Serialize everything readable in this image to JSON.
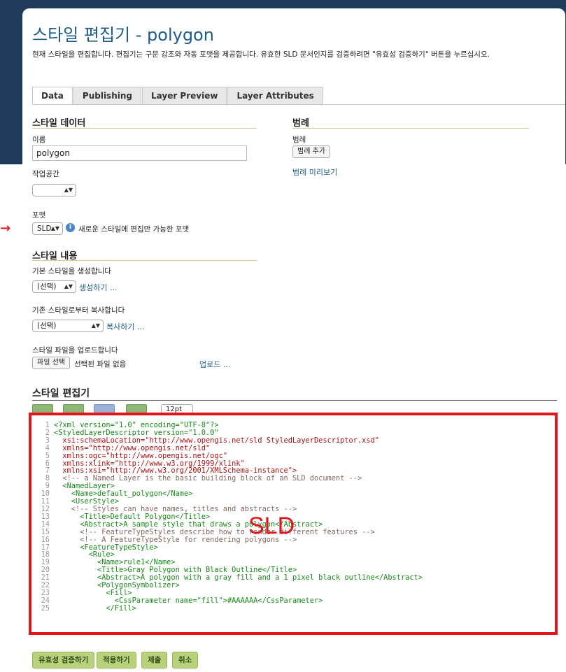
{
  "page": {
    "title": "스타일 편집기 - polygon",
    "subtitle": "현재 스타일을 편집합니다. 편집기는 구문 강조와 자동 포맷을 제공합니다. 유효한 SLD 문서인지를 검증하려면 \"유효성 검증하기\" 버튼을 누르십시오."
  },
  "tabs": [
    "Data",
    "Publishing",
    "Layer Preview",
    "Layer Attributes"
  ],
  "style_data": {
    "heading": "스타일 데이터",
    "name_label": "이름",
    "name_value": "polygon",
    "workspace_label": "작업공간",
    "workspace_value": "",
    "format_label": "포맷",
    "format_value": "SLD",
    "format_note": "새로운 스타일에 편집만 가능한 포맷"
  },
  "legend": {
    "heading": "범례",
    "label": "범례",
    "add_button": "범례 추가",
    "preview_link": "범례 미리보기"
  },
  "style_content": {
    "heading": "스타일 내용",
    "generate_label": "기본 스타일을 생성합니다",
    "generate_select": "(선택)",
    "generate_link": "생성하기 ...",
    "copy_label": "기존 스타일로부터 복사합니다",
    "copy_select": "(선택)",
    "copy_link": "복사하기 ...",
    "upload_label": "스타일 파일을 업로드합니다",
    "file_button": "파일 선택",
    "file_status": "선택된 파일 없음",
    "upload_link": "업로드 ..."
  },
  "editor": {
    "heading": "스타일 편집기",
    "font_size": "12pt",
    "overlay_label": "SLD",
    "lines": [
      "<?xml version=\"1.0\" encoding=\"UTF-8\"?>",
      "<StyledLayerDescriptor version=\"1.0.0\"",
      "  xsi:schemaLocation=\"http://www.opengis.net/sld StyledLayerDescriptor.xsd\"",
      "  xmlns=\"http://www.opengis.net/sld\"",
      "  xmlns:ogc=\"http://www.opengis.net/ogc\"",
      "  xmlns:xlink=\"http://www.w3.org/1999/xlink\"",
      "  xmlns:xsi=\"http://www.w3.org/2001/XMLSchema-instance\">",
      "  <!-- a Named Layer is the basic building block of an SLD document -->",
      "  <NamedLayer>",
      "    <Name>default_polygon</Name>",
      "    <UserStyle>",
      "    <!-- Styles can have names, titles and abstracts -->",
      "      <Title>Default Polygon</Title>",
      "      <Abstract>A sample style that draws a polygon</Abstract>",
      "      <!-- FeatureTypeStyles describe how to render different features -->",
      "      <!-- A FeatureTypeStyle for rendering polygons -->",
      "      <FeatureTypeStyle>",
      "        <Rule>",
      "          <Name>rule1</Name>",
      "          <Title>Gray Polygon with Black Outline</Title>",
      "          <Abstract>A polygon with a gray fill and a 1 pixel black outline</Abstract>",
      "          <PolygonSymbolizer>",
      "            <Fill>",
      "              <CssParameter name=\"fill\">#AAAAAA</CssParameter>",
      "            </Fill>"
    ]
  },
  "actions": [
    "유효성 검증하기",
    "적용하기",
    "제출",
    "취소"
  ]
}
